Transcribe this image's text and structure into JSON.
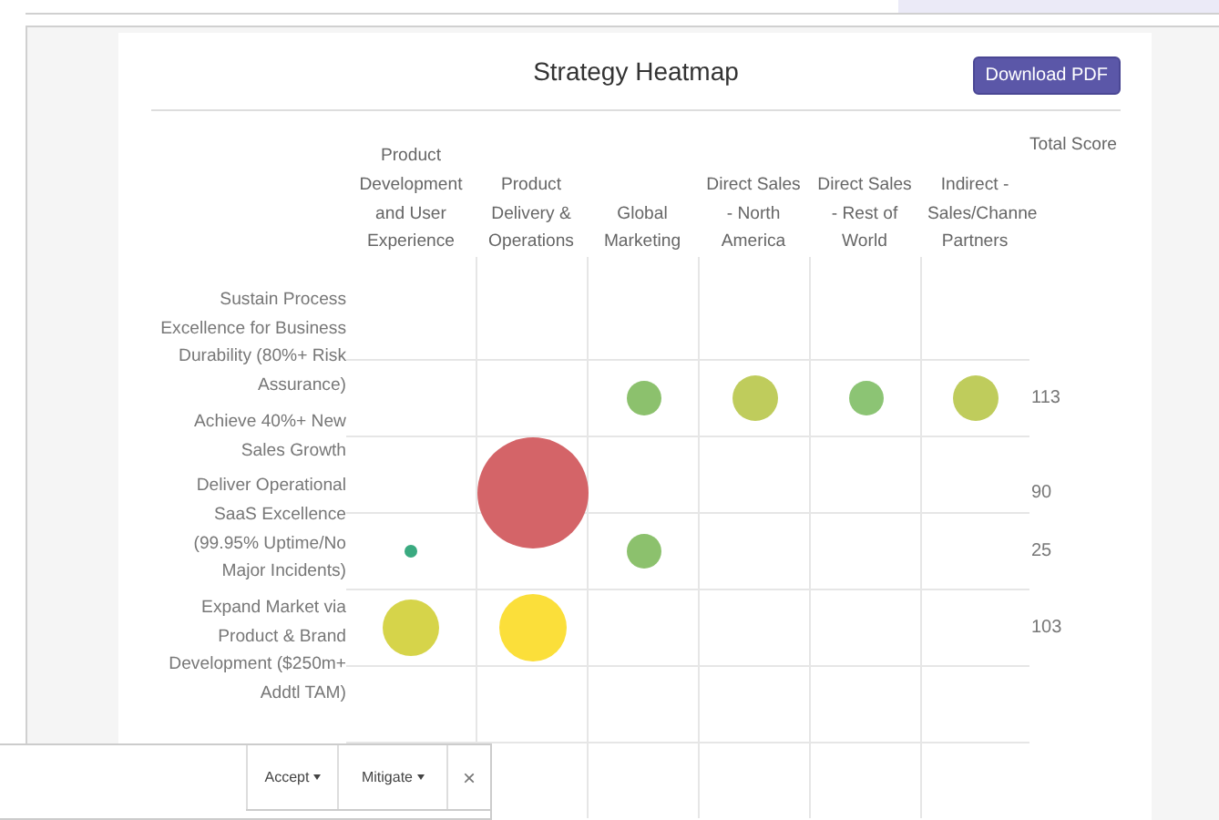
{
  "title": "Strategy Heatmap",
  "download_button": "Download PDF",
  "columns": [
    "Product Development and User Experience",
    "Product Delivery & Operations",
    "Global Marketing",
    "Direct Sales - North America",
    "Direct Sales - Rest of World",
    "Indirect -Sales/Channe Partners"
  ],
  "total_column": "Total Score",
  "row_labels": [
    "Sustain Process Excellence for Business Durability (80%+ Risk Assurance)",
    "Achieve 40%+ New Sales Growth",
    "Deliver Operational SaaS Excellence (99.95% Uptime/No Major Incidents)",
    "Expand Market via Product & Brand Development ($250m+ Addtl TAM)"
  ],
  "rows": [
    {
      "total": "113",
      "cells": [
        {
          "kind": "empty"
        },
        {
          "kind": "empty"
        },
        {
          "kind": "small",
          "color": "#8cc16d"
        },
        {
          "kind": "medium",
          "color": "#bfcc5c"
        },
        {
          "kind": "small",
          "color": "#8cc474"
        },
        {
          "kind": "medium",
          "color": "#bfcc5c"
        }
      ]
    },
    {
      "total": "90",
      "cells": [
        {
          "kind": "empty"
        },
        {
          "kind": "huge",
          "color": "#d46468"
        },
        {
          "kind": "empty"
        },
        {
          "kind": "empty"
        },
        {
          "kind": "empty"
        },
        {
          "kind": "empty"
        }
      ]
    },
    {
      "total": "25",
      "cells": [
        {
          "kind": "tiny",
          "color": "#3aaa80"
        },
        {
          "kind": "empty"
        },
        {
          "kind": "small",
          "color": "#8cc16d"
        },
        {
          "kind": "empty"
        },
        {
          "kind": "empty"
        },
        {
          "kind": "empty"
        }
      ]
    },
    {
      "total": "103",
      "cells": [
        {
          "kind": "large",
          "color": "#d6d44a"
        },
        {
          "kind": "larger",
          "color": "#fbdf3a"
        },
        {
          "kind": "empty"
        },
        {
          "kind": "empty"
        },
        {
          "kind": "empty"
        },
        {
          "kind": "empty"
        }
      ]
    }
  ],
  "action_bar": {
    "buttons": [
      "Accept",
      "Mitigate"
    ],
    "close": "×"
  }
}
